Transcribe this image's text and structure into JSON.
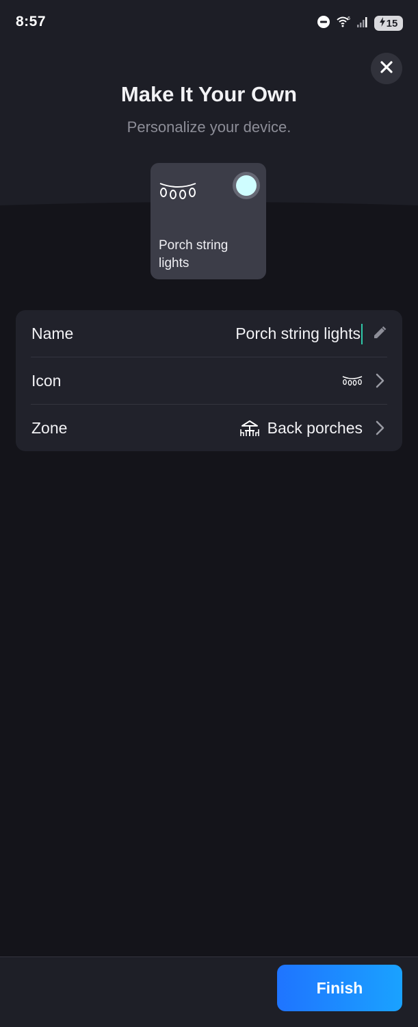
{
  "status_bar": {
    "time": "8:57",
    "battery_level": "15"
  },
  "header": {
    "title": "Make It Your Own",
    "subtitle": "Personalize your device."
  },
  "preview_card": {
    "icon": "string-lights-icon",
    "toggle_state": "on",
    "label": "Porch string lights"
  },
  "settings": {
    "name": {
      "label": "Name",
      "value": "Porch string lights",
      "action_icon": "pencil-icon"
    },
    "icon": {
      "label": "Icon",
      "value_icon": "string-lights-icon",
      "action_icon": "chevron-right-icon"
    },
    "zone": {
      "label": "Zone",
      "value": "Back porches",
      "value_icon": "porch-table-icon",
      "action_icon": "chevron-right-icon"
    }
  },
  "footer": {
    "finish_label": "Finish"
  },
  "colors": {
    "background": "#14141a",
    "header": "#1d1e26",
    "panel": "#21222b",
    "accent": "#1a8dff",
    "toggle_on": "#cffdff",
    "cursor": "#2fc9a9"
  }
}
